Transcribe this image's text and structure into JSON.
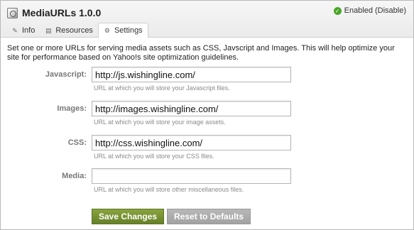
{
  "header": {
    "title": "MediaURLs 1.0.0",
    "status_text": "Enabled",
    "status_link": "(Disable)",
    "status_color": "#4aa526"
  },
  "tabs": [
    {
      "label": "Info",
      "icon": "info-icon"
    },
    {
      "label": "Resources",
      "icon": "resources-icon"
    },
    {
      "label": "Settings",
      "icon": "settings-icon",
      "active": true
    }
  ],
  "intro": "Set one or more URLs for serving media assets such as CSS, Javscript and Images. This will help optimize your site for performance based on Yahoo!s site optimization guidelines.",
  "fields": [
    {
      "label": "Javascript:",
      "value": "http://js.wishingline.com/",
      "hint": "URL at which you will store your Javascript files."
    },
    {
      "label": "Images:",
      "value": "http://images.wishingline.com/",
      "hint": "URL at which you will store your image assets."
    },
    {
      "label": "CSS:",
      "value": "http://css.wishingline.com/",
      "hint": "URL at which you will store your CSS files."
    },
    {
      "label": "Media:",
      "value": "",
      "hint": "URL at which you will store other miscellaneous files."
    }
  ],
  "buttons": {
    "save": "Save Changes",
    "reset": "Reset to Defaults"
  }
}
